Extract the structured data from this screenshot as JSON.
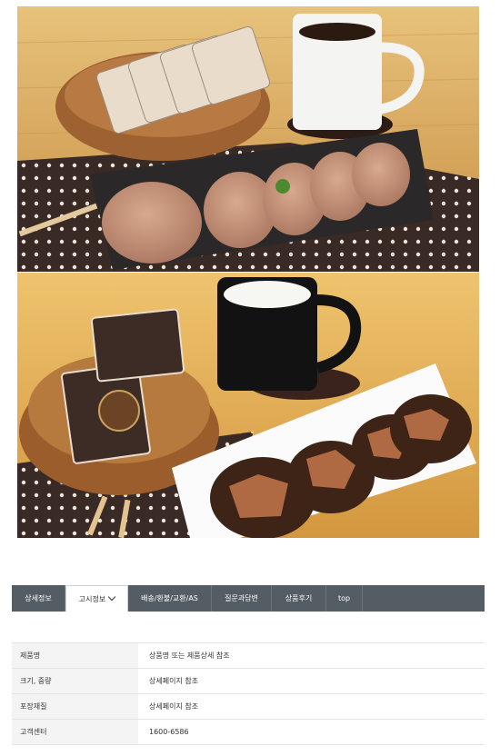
{
  "images": [
    {
      "name": "product-photo-dorayaki-coffee"
    },
    {
      "name": "product-photo-chocolate-milk"
    }
  ],
  "tabs": [
    {
      "label": "상세정보",
      "active": false
    },
    {
      "label": "고시정보",
      "active": true,
      "icon": "chevron-down-icon"
    },
    {
      "label": "배송/환불/교환/AS",
      "active": false
    },
    {
      "label": "질문과답변",
      "active": false
    },
    {
      "label": "상품후기",
      "active": false
    },
    {
      "label": "top",
      "active": false
    }
  ],
  "info_table": [
    {
      "label": "제품명",
      "value": "상품명 또는 제품상세 참조"
    },
    {
      "label": "크기, 중량",
      "value": "상세페이지 참조"
    },
    {
      "label": "포장재질",
      "value": "상세페이지 참조"
    },
    {
      "label": "고객센터",
      "value": "1600-6586"
    }
  ],
  "colors": {
    "tabbar": "#555d64",
    "active_tab": "#ffffff"
  }
}
